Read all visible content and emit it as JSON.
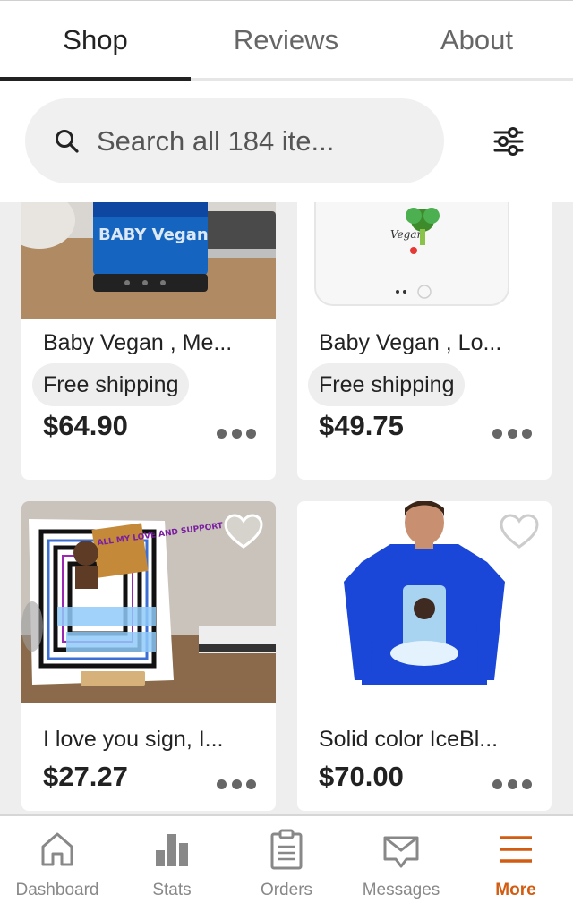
{
  "tabs": [
    {
      "label": "Shop",
      "active": true
    },
    {
      "label": "Reviews",
      "active": false
    },
    {
      "label": "About",
      "active": false
    }
  ],
  "search": {
    "placeholder": "Search all 184 ite...",
    "icon": "search-icon",
    "filter_icon": "filter-sliders-icon"
  },
  "listings": [
    {
      "title": "Baby Vegan , Me...",
      "shipping": "Free shipping",
      "price": "$64.90",
      "image": "blue-speaker-photo",
      "image_text": "BABY Vegan"
    },
    {
      "title": "Baby Vegan , Lo...",
      "shipping": "Free shipping",
      "price": "$49.75",
      "image": "white-device-photo",
      "image_text": "Vegan"
    },
    {
      "title": "I love you sign, I...",
      "price": "$27.27",
      "image": "acrylic-sign-photo",
      "image_text": "ALL MY LOVE AND SUPPORT"
    },
    {
      "title": "Solid color IceBl...",
      "price": "$70.00",
      "image": "blue-sweatshirt-photo"
    }
  ],
  "bottom_nav": [
    {
      "label": "Dashboard",
      "icon": "house-icon",
      "active": false
    },
    {
      "label": "Stats",
      "icon": "bar-chart-icon",
      "active": false
    },
    {
      "label": "Orders",
      "icon": "clipboard-icon",
      "active": false
    },
    {
      "label": "Messages",
      "icon": "envelope-icon",
      "active": false
    },
    {
      "label": "More",
      "icon": "menu-icon",
      "active": true
    }
  ],
  "colors": {
    "accent": "#d25c11",
    "text": "#222222",
    "muted": "#888888",
    "background": "#eeeeee"
  }
}
